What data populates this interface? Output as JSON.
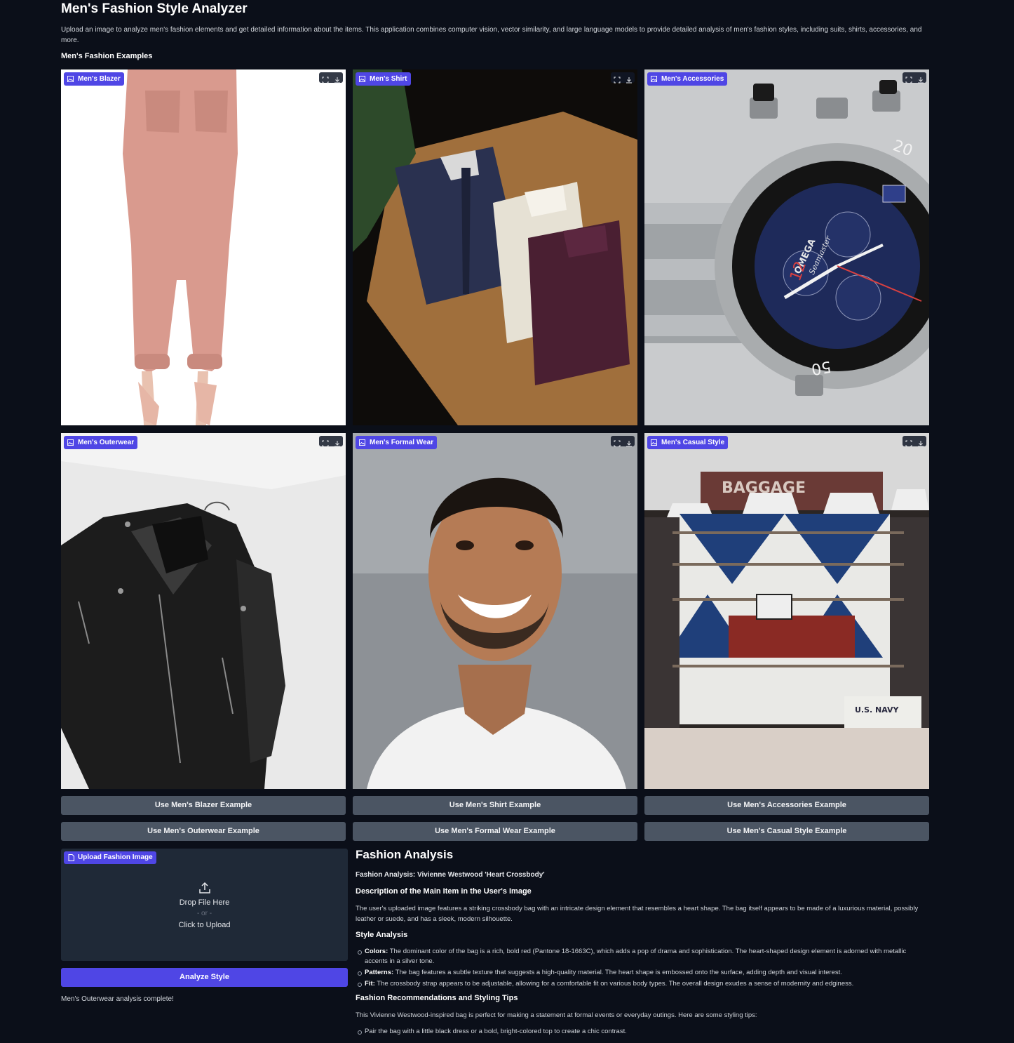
{
  "page": {
    "title": "Men's Fashion Style Analyzer",
    "intro": "Upload an image to analyze men's fashion elements and get detailed information about the items. This application combines computer vision, vector similarity, and large language models to provide detailed analysis of men's fashion styles, including suits, shirts, accessories, and more.",
    "examples_heading": "Men's Fashion Examples"
  },
  "gallery": [
    {
      "label": "Men's Blazer",
      "image": "pink-jogger-pants-photo"
    },
    {
      "label": "Men's Shirt",
      "image": "folded-dress-shirts-photo"
    },
    {
      "label": "Men's Accessories",
      "image": "omega-seamaster-watch-photo"
    },
    {
      "label": "Men's Outerwear",
      "image": "black-leather-jacket-photo"
    },
    {
      "label": "Men's Formal Wear",
      "image": "smiling-man-portrait-photo"
    },
    {
      "label": "Men's Casual Style",
      "image": "clothing-store-interior-photo"
    }
  ],
  "watch_text": {
    "brand": "OMEGA",
    "model": "Seamaster",
    "bezel_20": "20",
    "bezel_50": "50"
  },
  "store_text": {
    "sign": "BAGGAGE",
    "navy": "U.S. NAVY"
  },
  "example_buttons": [
    "Use Men's Blazer Example",
    "Use Men's Shirt Example",
    "Use Men's Accessories Example",
    "Use Men's Outerwear Example",
    "Use Men's Formal Wear Example",
    "Use Men's Casual Style Example"
  ],
  "upload": {
    "label": "Upload Fashion Image",
    "drop_text": "Drop File Here",
    "or_text": "- or -",
    "click_text": "Click to Upload"
  },
  "analyze_button": "Analyze Style",
  "status": "Men's Outerwear analysis complete!",
  "analysis": {
    "heading": "Fashion Analysis",
    "subtitle": "Fashion Analysis: Vivienne Westwood 'Heart Crossbody'",
    "description_heading": "Description of the Main Item in the User's Image",
    "description": "The user's uploaded image features a striking crossbody bag with an intricate design element that resembles a heart shape. The bag itself appears to be made of a luxurious material, possibly leather or suede, and has a sleek, modern silhouette.",
    "style_heading": "Style Analysis",
    "style_items": [
      {
        "term": "Colors:",
        "text": "The dominant color of the bag is a rich, bold red (Pantone 18-1663C), which adds a pop of drama and sophistication. The heart-shaped design element is adorned with metallic accents in a silver tone."
      },
      {
        "term": "Patterns:",
        "text": "The bag features a subtle texture that suggests a high-quality material. The heart shape is embossed onto the surface, adding depth and visual interest."
      },
      {
        "term": "Fit:",
        "text": "The crossbody strap appears to be adjustable, allowing for a comfortable fit on various body types. The overall design exudes a sense of modernity and edginess."
      }
    ],
    "recommend_heading": "Fashion Recommendations and Styling Tips",
    "recommend_intro": "This Vivienne Westwood-inspired bag is perfect for making a statement at formal events or everyday outings. Here are some styling tips:",
    "tips": [
      "Pair the bag with a little black dress or a bold, bright-colored top to create a chic contrast."
    ]
  },
  "colors": {
    "background": "#0b0f19",
    "panel": "#1f2937",
    "accent": "#4f46e5",
    "button": "#4b5563"
  }
}
